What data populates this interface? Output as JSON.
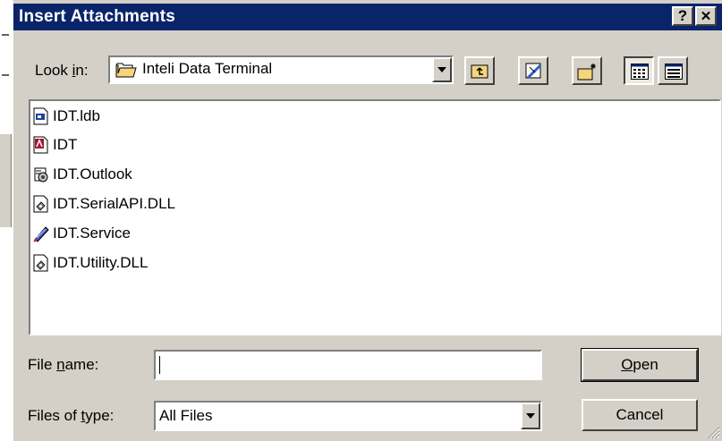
{
  "dialog": {
    "title": "Insert Attachments",
    "help_button": "?",
    "close_button": "✕"
  },
  "look_in": {
    "label_pre": "Look ",
    "label_accel": "i",
    "label_post": "n:",
    "value": "Inteli Data Terminal",
    "icon": "folder-icon"
  },
  "toolbar": {
    "buttons": [
      {
        "name": "up-one-level",
        "icon": "up-folder-icon"
      },
      {
        "name": "desktop",
        "icon": "desktop-icon"
      },
      {
        "name": "create-new-folder",
        "icon": "new-folder-icon"
      },
      {
        "name": "list-view",
        "icon": "list-view-icon",
        "pressed": true
      },
      {
        "name": "details-view",
        "icon": "details-view-icon",
        "pressed": false
      }
    ]
  },
  "files": [
    {
      "name": "IDT.ldb",
      "icon": "ldb-file-icon"
    },
    {
      "name": "IDT",
      "icon": "access-db-icon"
    },
    {
      "name": "IDT.Outlook",
      "icon": "outlook-cert-icon"
    },
    {
      "name": "IDT.SerialAPI.DLL",
      "icon": "dll-file-icon"
    },
    {
      "name": "IDT.Service",
      "icon": "service-icon"
    },
    {
      "name": "IDT.Utility.DLL",
      "icon": "dll-file-icon"
    }
  ],
  "file_name": {
    "label_pre": "File ",
    "label_accel": "n",
    "label_post": "ame:",
    "value": ""
  },
  "files_of_type": {
    "label_pre": "Files of ",
    "label_accel": "t",
    "label_post": "ype:",
    "value": "All Files"
  },
  "buttons": {
    "open_accel": "O",
    "open_rest": "pen",
    "cancel": "Cancel"
  },
  "colors": {
    "titlebar": "#0a246a",
    "face": "#d4d0c8",
    "list_bg": "#ffffff"
  }
}
